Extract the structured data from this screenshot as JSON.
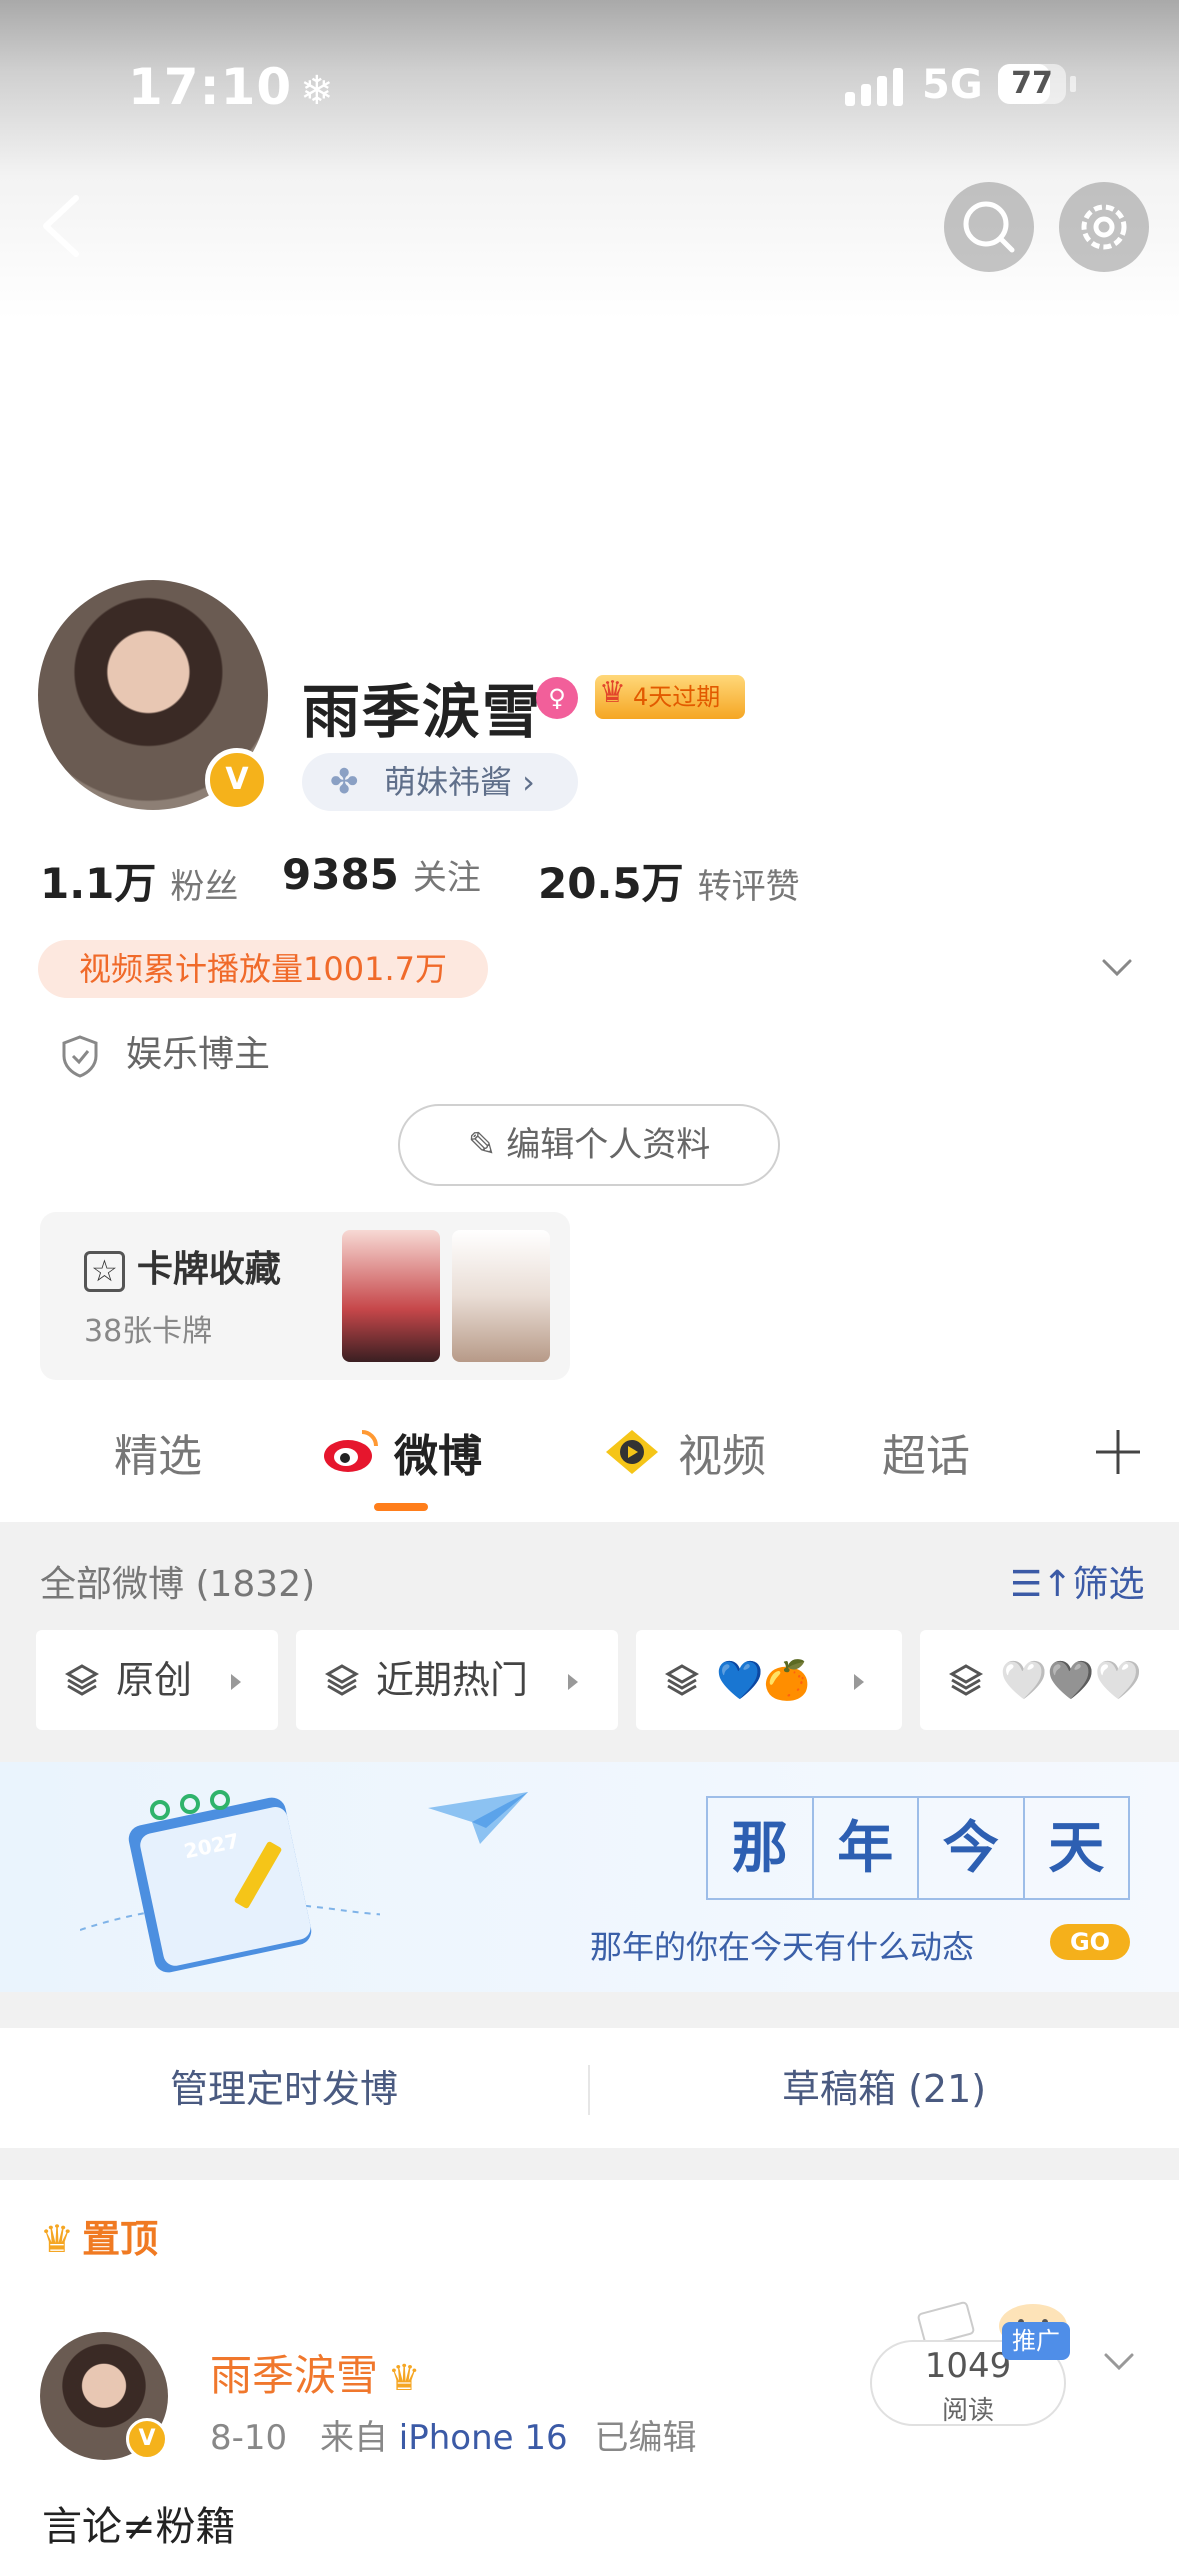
{
  "status_bar": {
    "time": "17:10",
    "time_icon": "snowflake-icon",
    "network": "5G",
    "battery": "77",
    "battery_level": 0.77
  },
  "header": {
    "back_icon": "back-arrow-icon",
    "search_icon": "search-icon",
    "settings_icon": "gear-icon"
  },
  "profile": {
    "name": "雨季涙雪",
    "vip_badge": "4天过期",
    "fan_club": "萌妹祎酱 ›",
    "stats": [
      {
        "value": "1.1万",
        "label": "粉丝"
      },
      {
        "value": "9385",
        "label": "关注"
      },
      {
        "value": "20.5万",
        "label": "转评赞"
      }
    ],
    "play_count": "视频累计播放量1001.7万",
    "tag": "娱乐博主",
    "edit_button": "编辑个人资料",
    "card": {
      "title": "卡牌收藏",
      "subtitle": "38张卡牌"
    }
  },
  "tabs": [
    {
      "label": "精选",
      "active": false
    },
    {
      "label": "微博",
      "active": true
    },
    {
      "label": "视频",
      "active": false
    },
    {
      "label": "超话",
      "active": false
    }
  ],
  "feed": {
    "all_count": "全部微博 (1832)",
    "filter_label": "筛选",
    "chips": [
      {
        "label": "原创"
      },
      {
        "label": "近期热门"
      },
      {
        "label": "💙🍊"
      },
      {
        "label": "🤍🩶🤍"
      }
    ],
    "banner": {
      "title_chars": [
        "那",
        "年",
        "今",
        "天"
      ],
      "subtitle": "那年的你在今天有什么动态",
      "go": "GO",
      "calendar_year": "2027"
    },
    "manage_scheduled": "管理定时发博",
    "drafts": "草稿箱 (21)"
  },
  "pinned_post": {
    "pinned_label": "置顶",
    "author": "雨季涙雪",
    "date": "8-10",
    "source_prefix": "来自",
    "device": "iPhone 16",
    "edited": "已编辑",
    "read_count": "1049",
    "read_label": "阅读",
    "promo_label": "推广",
    "text": "言论≠粉籍"
  }
}
